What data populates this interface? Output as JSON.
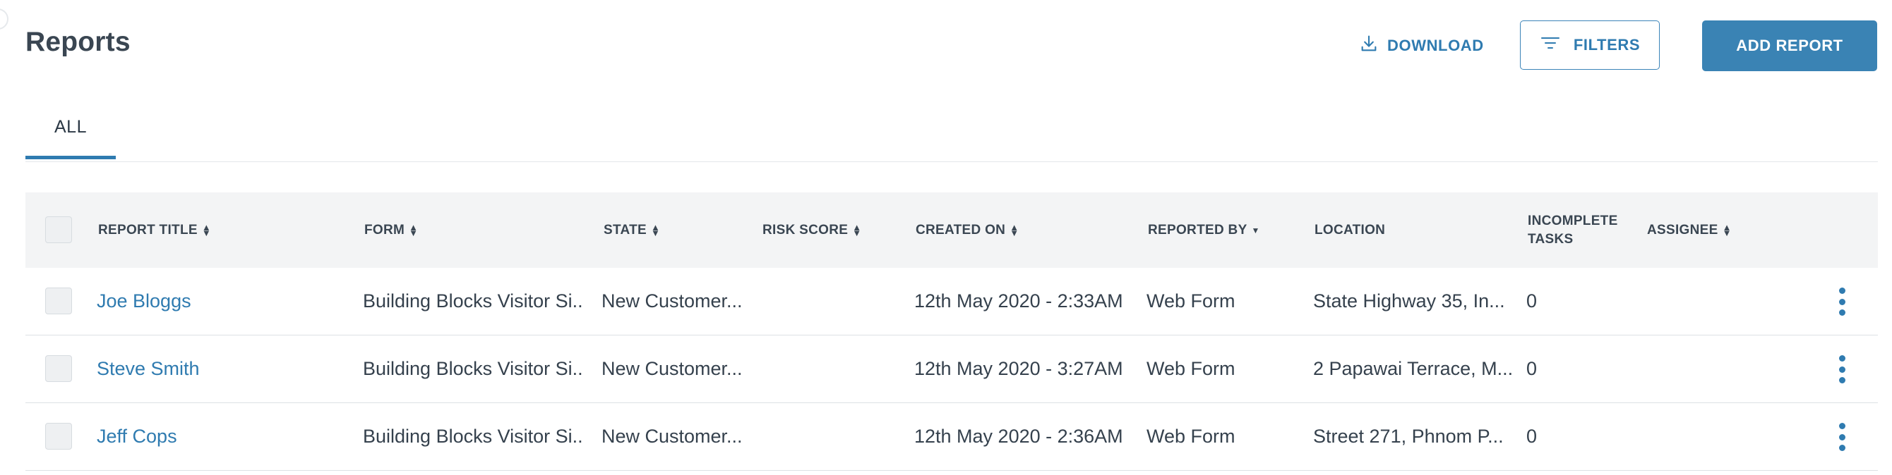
{
  "header": {
    "title": "Reports",
    "download_label": "DOWNLOAD",
    "filters_label": "FILTERS",
    "add_label": "ADD REPORT"
  },
  "tabs": [
    {
      "label": "ALL",
      "active": true
    }
  ],
  "table": {
    "columns": [
      {
        "label": "REPORT TITLE",
        "sort": "both"
      },
      {
        "label": "FORM",
        "sort": "both"
      },
      {
        "label": "STATE",
        "sort": "both"
      },
      {
        "label": "RISK SCORE",
        "sort": "both"
      },
      {
        "label": "CREATED ON",
        "sort": "both"
      },
      {
        "label": "REPORTED BY",
        "sort": "desc"
      },
      {
        "label": "LOCATION",
        "sort": "none"
      },
      {
        "label": "INCOMPLETE TASKS",
        "line1": "INCOMPLETE",
        "line2": "TASKS",
        "sort": "none"
      },
      {
        "label": "ASSIGNEE",
        "sort": "both"
      }
    ],
    "rows": [
      {
        "title": "Joe Bloggs",
        "form": "Building Blocks Visitor Si...",
        "state": "New Customer...",
        "risk_score": "",
        "created_on": "12th May 2020 - 2:33AM",
        "reported_by": "Web Form",
        "location": "State Highway 35, In...",
        "incomplete_tasks": "0",
        "assignee": ""
      },
      {
        "title": "Steve Smith",
        "form": "Building Blocks Visitor Si...",
        "state": "New Customer...",
        "risk_score": "",
        "created_on": "12th May 2020 - 3:27AM",
        "reported_by": "Web Form",
        "location": "2 Papawai Terrace, M...",
        "incomplete_tasks": "0",
        "assignee": ""
      },
      {
        "title": "Jeff Cops",
        "form": "Building Blocks Visitor Si...",
        "state": "New Customer...",
        "risk_score": "",
        "created_on": "12th May 2020 - 2:36AM",
        "reported_by": "Web Form",
        "location": "Street 271, Phnom P...",
        "incomplete_tasks": "0",
        "assignee": ""
      }
    ]
  },
  "colors": {
    "accent": "#2f7bb0",
    "button_fill": "#3a83b4",
    "header_bg": "#f3f4f5"
  },
  "icons": [
    "download-icon",
    "filter-icon",
    "sort-icon",
    "kebab-menu-icon"
  ]
}
